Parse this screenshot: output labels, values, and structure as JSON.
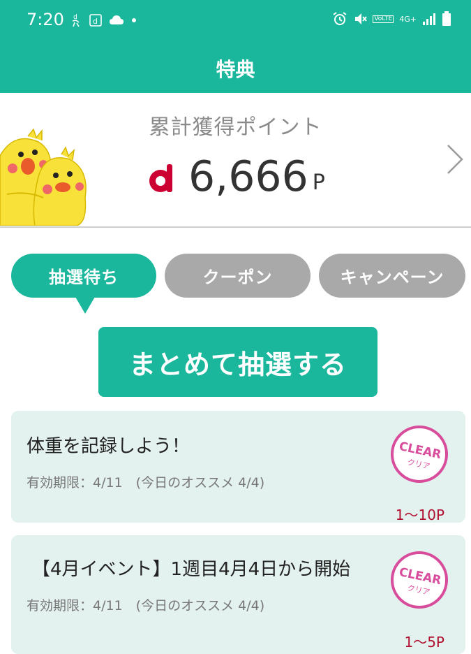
{
  "status_bar": {
    "time": "7:20",
    "left_icons": [
      "d-walk-icon",
      "d-icon",
      "cloud-icon",
      "dot-icon"
    ],
    "right_icons": [
      "alarm-icon",
      "mute-icon",
      "volte-icon",
      "4g-icon",
      "signal-icon",
      "battery-icon"
    ],
    "volte_text": "VoLTE",
    "network_text": "4G+"
  },
  "app_bar": {
    "title": "特典"
  },
  "points": {
    "label": "累計獲得ポイント",
    "value": "6,666",
    "unit": "P"
  },
  "tabs": [
    {
      "label": "抽選待ち",
      "active": true
    },
    {
      "label": "クーポン",
      "active": false
    },
    {
      "label": "キャンペーン",
      "active": false
    }
  ],
  "lottery_button": {
    "label": "まとめて抽選する"
  },
  "cards": [
    {
      "title": "体重を記録しよう！",
      "expiry": "有効期限：4/11　(今日のオススメ 4/4)",
      "stamp_text": "CLEAR",
      "stamp_subtext": "クリア",
      "reward": "1〜10P"
    },
    {
      "title": "【4月イベント】1週目4月4日から開始",
      "expiry": "有効期限：4/11　(今日のオススメ 4/4)",
      "stamp_text": "CLEAR",
      "stamp_subtext": "クリア",
      "reward": "1〜5P"
    }
  ],
  "colors": {
    "accent": "#1bb79c",
    "tab_inactive": "#a9a9a9",
    "card_bg": "#e4f2ef",
    "stamp": "#d84c9c",
    "reward": "#b01030",
    "d_logo": "#cc0033"
  }
}
